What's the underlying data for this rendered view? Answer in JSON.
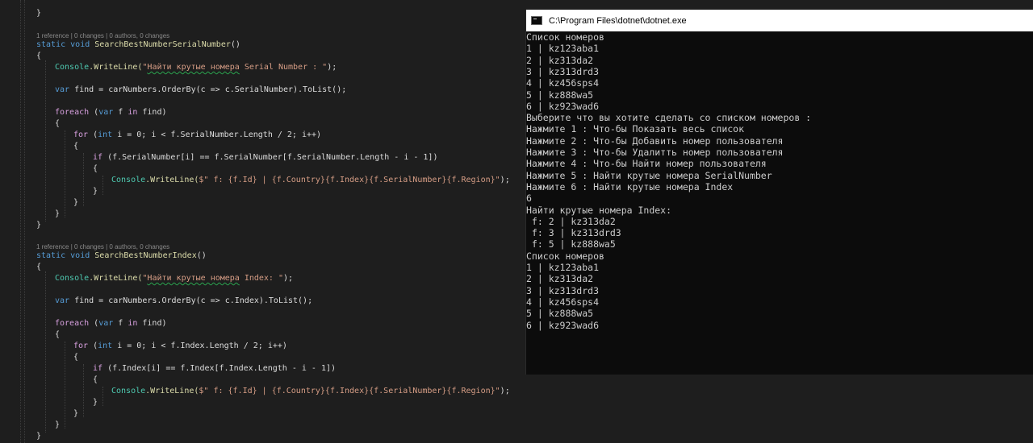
{
  "editor": {
    "top_brace": "}",
    "method1": {
      "codelens": "1 reference | 0 changes | 0 authors, 0 changes",
      "signature_kw1": "static",
      "signature_kw2": "void",
      "signature_name": "SearchBestNumberSerialNumber",
      "signature_parens": "()",
      "open_brace": "{",
      "writeline_class": "Console",
      "writeline_method": ".WriteLine(",
      "writeline_str_prefix": "\"",
      "writeline_str_ru": "Найти крутые номера",
      "writeline_str_rest": " Serial Number : \"",
      "writeline_end": ");",
      "var_kw": "var",
      "var_rest": " find = carNumbers.OrderBy(c => c.SerialNumber).ToList();",
      "foreach_kw": "foreach",
      "foreach_mid": " (",
      "foreach_var": "var",
      "foreach_f": " f ",
      "foreach_in": "in",
      "foreach_end": " find)",
      "brace2": "{",
      "for_kw": "for",
      "for_int": "int",
      "for_rest": " i = 0; i < f.SerialNumber.Length / 2; i++)",
      "brace3": "{",
      "if_kw": "if",
      "if_rest": " (f.SerialNumber[i] == f.SerialNumber[f.SerialNumber.Length - i - 1])",
      "brace4": "{",
      "inner_class": "Console",
      "inner_method": ".WriteLine(",
      "inner_str": "$\" f: {f.Id} | {f.Country}{f.Index}{f.SerialNumber}{f.Region}\"",
      "inner_end": ");",
      "close4": "}",
      "close3": "}",
      "close2": "}",
      "close1": "}"
    },
    "method2": {
      "codelens": "1 reference | 0 changes | 0 authors, 0 changes",
      "signature_kw1": "static",
      "signature_kw2": "void",
      "signature_name": "SearchBestNumberIndex",
      "signature_parens": "()",
      "open_brace": "{",
      "writeline_class": "Console",
      "writeline_method": ".WriteLine(",
      "writeline_str_prefix": "\"",
      "writeline_str_ru": "Найти крутые номера",
      "writeline_str_rest": " Index: \"",
      "writeline_end": ");",
      "var_kw": "var",
      "var_rest": " find = carNumbers.OrderBy(c => c.Index).ToList();",
      "foreach_kw": "foreach",
      "foreach_mid": " (",
      "foreach_var": "var",
      "foreach_f": " f ",
      "foreach_in": "in",
      "foreach_end": " find)",
      "brace2": "{",
      "for_kw": "for",
      "for_int": "int",
      "for_rest": " i = 0; i < f.Index.Length / 2; i++)",
      "brace3": "{",
      "if_kw": "if",
      "if_rest": " (f.Index[i] == f.Index[f.Index.Length - i - 1])",
      "brace4": "{",
      "inner_class": "Console",
      "inner_method": ".WriteLine(",
      "inner_str": "$\" f: {f.Id} | {f.Country}{f.Index}{f.SerialNumber}{f.Region}\"",
      "inner_end": ");",
      "close4": "}",
      "close3": "}",
      "close2": "}",
      "close1": "}"
    }
  },
  "console": {
    "title": "C:\\Program Files\\dotnet\\dotnet.exe",
    "icon": "console-app-icon",
    "lines": [
      "Список номеров",
      "1 | kz123aba1",
      "2 | kz313da2",
      "3 | kz313drd3",
      "4 | kz456sps4",
      "5 | kz888wa5",
      "6 | kz923wad6",
      "Выберите что вы хотите сделать со списком номеров :",
      "Нажмите 1 : Что-бы Показать весь список",
      "Нажмите 2 : Что-бы Добавить номер пользователя",
      "Нажмите 3 : Что-бы Удалитть номер пользователя",
      "Нажмите 4 : Что-бы Найти номер пользователя",
      "Нажмите 5 : Найти крутые номера SerialNumber",
      "Нажмите 6 : Найти крутые номера Index",
      "6",
      "Найти крутые номера Index:",
      " f: 2 | kz313da2",
      " f: 3 | kz313drd3",
      " f: 5 | kz888wa5",
      "Список номеров",
      "1 | kz123aba1",
      "2 | kz313da2",
      "3 | kz313drd3",
      "4 | kz456sps4",
      "5 | kz888wa5",
      "6 | kz923wad6"
    ]
  }
}
